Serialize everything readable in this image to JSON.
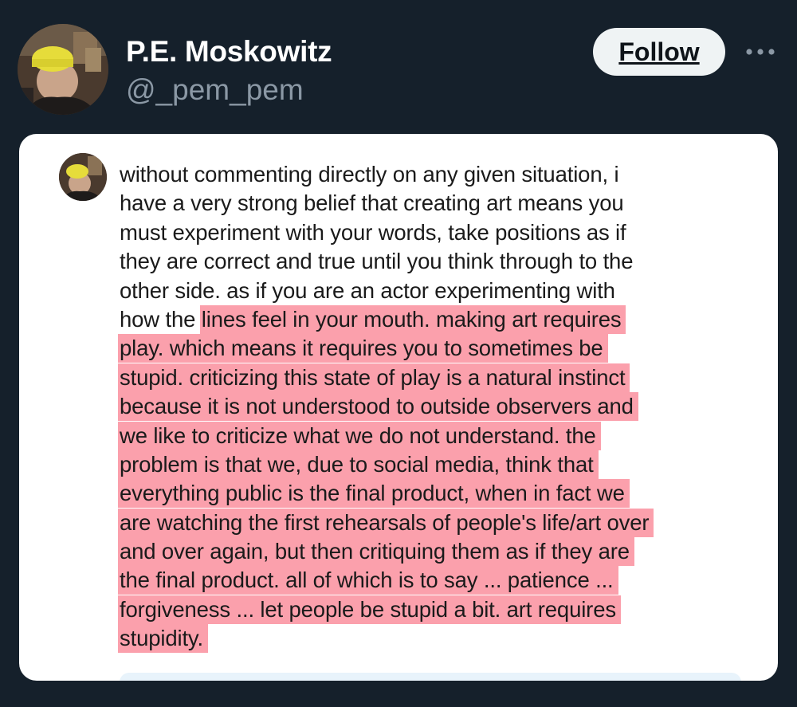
{
  "header": {
    "display_name": "P.E. Moskowitz",
    "handle": "@_pem_pem",
    "follow_label": "Follow",
    "more_icon": "more-horizontal-icon"
  },
  "colors": {
    "background": "#15202b",
    "follow_button_bg": "#eff3f4",
    "highlight": "#fba0ac",
    "card_bg": "#ffffff"
  },
  "post": {
    "lines": [
      {
        "plain": "without commenting directly on any given situation, i",
        "highlighted": ""
      },
      {
        "plain": "have a very strong belief that creating art means you",
        "highlighted": ""
      },
      {
        "plain": "must experiment with your words, take positions as if",
        "highlighted": ""
      },
      {
        "plain": "they are correct and true until you think through to the",
        "highlighted": ""
      },
      {
        "plain": "other side. as if you are an actor experimenting with",
        "highlighted": ""
      },
      {
        "plain": "how the",
        "highlighted": "lines feel in your mouth. making art requires"
      },
      {
        "plain": "",
        "highlighted": "play. which means it requires you to sometimes be"
      },
      {
        "plain": "",
        "highlighted": "stupid. criticizing this state of play is a natural instinct"
      },
      {
        "plain": "",
        "highlighted": "because it is not understood to outside observers and"
      },
      {
        "plain": "",
        "highlighted": "we like to criticize what we do not understand. the"
      },
      {
        "plain": "",
        "highlighted": "problem is that we, due to social media, think that"
      },
      {
        "plain": "",
        "highlighted": "everything public is the final product, when in fact we"
      },
      {
        "plain": "",
        "highlighted": "are watching the first rehearsals of people's life/art over"
      },
      {
        "plain": "",
        "highlighted": "and over again, but then critiquing them as if they are"
      },
      {
        "plain": "",
        "highlighted": "the final product. all of which is to say ... patience ..."
      },
      {
        "plain": "",
        "highlighted": "forgiveness ... let people be stupid a bit. art requires"
      },
      {
        "plain": "",
        "highlighted": "stupidity."
      }
    ]
  }
}
